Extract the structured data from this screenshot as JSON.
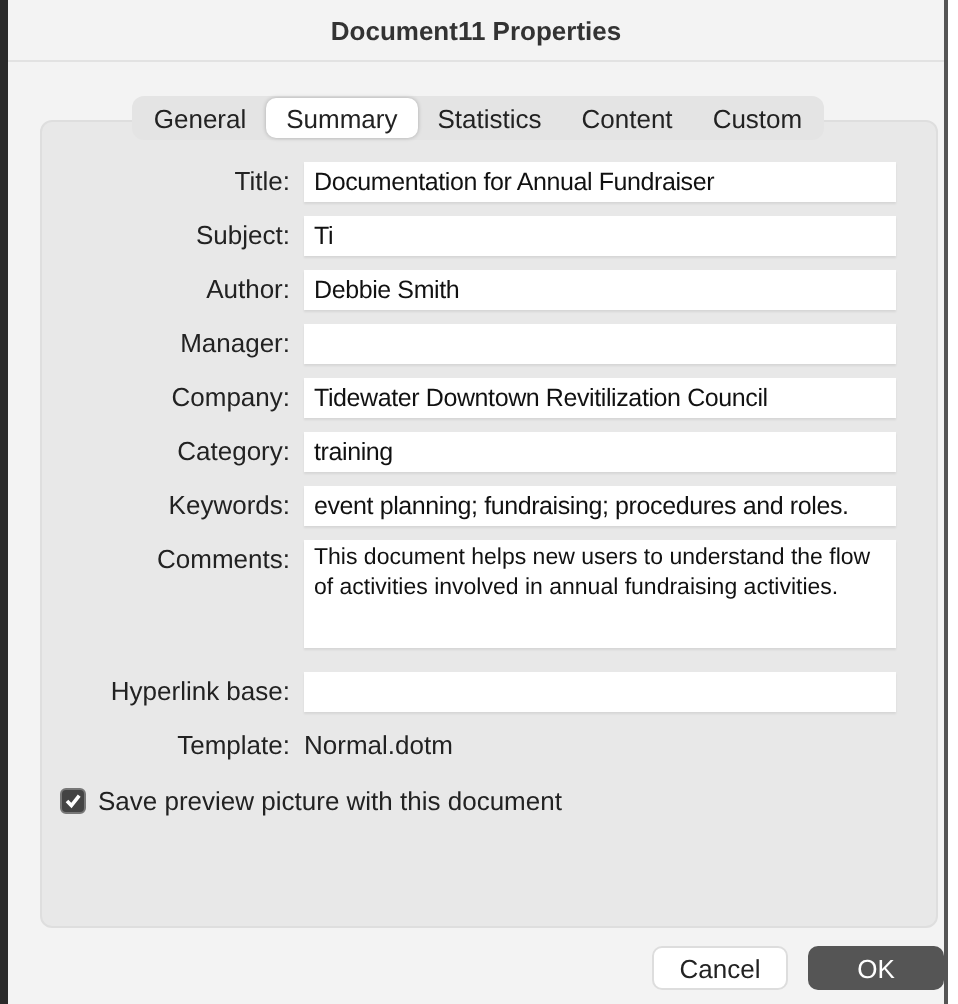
{
  "window": {
    "title": "Document11 Properties"
  },
  "tabs": [
    {
      "label": "General",
      "selected": false
    },
    {
      "label": "Summary",
      "selected": true
    },
    {
      "label": "Statistics",
      "selected": false
    },
    {
      "label": "Content",
      "selected": false
    },
    {
      "label": "Custom",
      "selected": false
    }
  ],
  "fields": [
    {
      "label": "Title:",
      "kind": "text",
      "value": "Documentation for Annual Fundraiser"
    },
    {
      "label": "Subject:",
      "kind": "text",
      "value": "Ti"
    },
    {
      "label": "Author:",
      "kind": "text",
      "value": "Debbie Smith"
    },
    {
      "label": "Manager:",
      "kind": "text"
    },
    {
      "label": "Company:",
      "kind": "text",
      "value": "Tidewater Downtown Revitilization Council"
    },
    {
      "label": "Category:",
      "kind": "text",
      "value": "training"
    },
    {
      "label": "Keywords:",
      "kind": "text",
      "value": "event planning; fundraising; procedures and roles."
    },
    {
      "label": "Comments:",
      "kind": "multiline",
      "value": "This document helps new users to understand the flow of activities involved in annual fundraising activities."
    },
    {
      "label": "Hyperlink base:",
      "kind": "text"
    },
    {
      "label": "Template:",
      "kind": "static",
      "value": "Normal.dotm"
    }
  ],
  "save_preview": {
    "label": "Save preview picture with this document",
    "checked": true
  },
  "buttons": [
    {
      "label": "Cancel",
      "kind": "secondary"
    },
    {
      "label": "OK",
      "kind": "primary"
    }
  ]
}
